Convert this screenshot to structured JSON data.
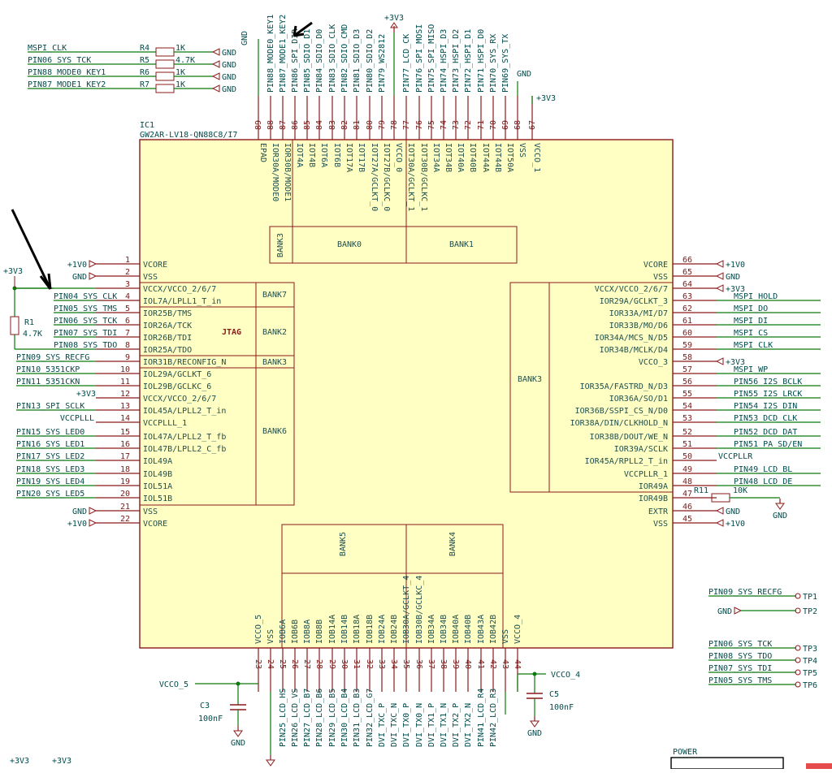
{
  "chip": {
    "ref": "IC1",
    "part": "GW2AR-LV18-QN88C8/I7",
    "epad": "EPAD"
  },
  "banks": {
    "top_left": "BANK3",
    "top_mid": "BANK0",
    "top_right": "BANK1",
    "left_b7": "BANK7",
    "left_b2": "BANK2",
    "left_jtag": "JTAG",
    "left_b3": "BANK3",
    "left_b6": "BANK6",
    "right_b3": "BANK3",
    "bottom_b5": "BANK5",
    "bottom_b4": "BANK4"
  },
  "left_pins": [
    {
      "num": "1",
      "name": "VCORE",
      "net": "+1V0"
    },
    {
      "num": "2",
      "name": "VSS",
      "net": "GND"
    },
    {
      "num": "3",
      "name": "VCCX/VCCO_2/6/7",
      "net": "+3V3"
    },
    {
      "num": "4",
      "name": "IOL7A/LPLL1_T_in",
      "net": "PIN04_SYS_CLK"
    },
    {
      "num": "5",
      "name": "IOR25B/TMS",
      "net": "PIN05_SYS_TMS"
    },
    {
      "num": "6",
      "name": "IOR26A/TCK",
      "net": "PIN06_SYS_TCK"
    },
    {
      "num": "7",
      "name": "IOR26B/TDI",
      "net": "PIN07_SYS_TDI"
    },
    {
      "num": "8",
      "name": "IOR25A/TDO",
      "net": "PIN08_SYS_TDO"
    },
    {
      "num": "9",
      "name": "IOR31B/RECONFIG_N",
      "net": "PIN09_SYS_RECFG"
    },
    {
      "num": "10",
      "name": "IOL29A/GCLKT_6",
      "net": "PIN10_5351CKP"
    },
    {
      "num": "11",
      "name": "IOL29B/GCLKC_6",
      "net": "PIN11_5351CKN"
    },
    {
      "num": "12",
      "name": "VCCX/VCCO_2/6/7",
      "net": "+3V3"
    },
    {
      "num": "13",
      "name": "IOL45A/LPLL2_T_in",
      "net": "PIN13_SPI_SCLK"
    },
    {
      "num": "14",
      "name": "VCCPLLL_1",
      "net": "VCCPLLL"
    },
    {
      "num": "15",
      "name": "IOL47A/LPLL2_T_fb",
      "net": "PIN15_SYS_LED0"
    },
    {
      "num": "16",
      "name": "IOL47B/LPLL2_C_fb",
      "net": "PIN16_SYS_LED1"
    },
    {
      "num": "17",
      "name": "IOL49A",
      "net": "PIN17_SYS_LED2"
    },
    {
      "num": "18",
      "name": "IOL49B",
      "net": "PIN18_SYS_LED3"
    },
    {
      "num": "19",
      "name": "IOL51A",
      "net": "PIN19_SYS_LED4"
    },
    {
      "num": "20",
      "name": "IOL51B",
      "net": "PIN20_SYS_LED5"
    },
    {
      "num": "21",
      "name": "VSS",
      "net": "GND"
    },
    {
      "num": "22",
      "name": "VCORE",
      "net": "+1V0"
    }
  ],
  "right_pins": [
    {
      "num": "66",
      "name": "VCORE",
      "net": "+1V0"
    },
    {
      "num": "65",
      "name": "VSS",
      "net": "GND"
    },
    {
      "num": "64",
      "name": "VCCX/VCCO_2/6/7",
      "net": "+3V3"
    },
    {
      "num": "63",
      "name": "IOR29A/GCLKT_3",
      "net": "MSPI_HOLD"
    },
    {
      "num": "62",
      "name": "IOR33A/MI/D7",
      "net": "MSPI_DO"
    },
    {
      "num": "61",
      "name": "IOR33B/MO/D6",
      "net": "MSPI_DI"
    },
    {
      "num": "60",
      "name": "IOR34A/MCS_N/D5",
      "net": "MSPI_CS"
    },
    {
      "num": "59",
      "name": "IOR34B/MCLK/D4",
      "net": "MSPI_CLK"
    },
    {
      "num": "58",
      "name": "VCCO_3",
      "net": "+3V3"
    },
    {
      "num": "57",
      "name": "",
      "net": "MSPI_WP"
    },
    {
      "num": "56",
      "name": "IOR35A/FASTRD_N/D3",
      "net": "PIN56_I2S_BCLK"
    },
    {
      "num": "55",
      "name": "IOR36A/SO/D1",
      "net": "PIN55_I2S_LRCK"
    },
    {
      "num": "54",
      "name": "IOR36B/SSPI_CS_N/D0",
      "net": "PIN54_I2S_DIN"
    },
    {
      "num": "53",
      "name": "IOR38A/DIN/CLKHOLD_N",
      "net": "PIN53_DCD_CLK"
    },
    {
      "num": "52",
      "name": "IOR38B/DOUT/WE_N",
      "net": "PIN52_DCD_DAT"
    },
    {
      "num": "51",
      "name": "IOR39A/SCLK",
      "net": "PIN51_PA_SD/EN"
    },
    {
      "num": "50",
      "name": "IOR45A/RPLL2_T_in",
      "net": "VCCPLLR"
    },
    {
      "num": "49",
      "name": "VCCPLLR_1",
      "net": "PIN49_LCD_BL"
    },
    {
      "num": "48",
      "name": "IOR49A",
      "net": "PIN48_LCD_DE"
    },
    {
      "num": "47",
      "name": "IOR49B",
      "net": "R11"
    },
    {
      "num": "46",
      "name": "EXTR",
      "net": "GND"
    },
    {
      "num": "45",
      "name": "VSS",
      "net": "+1V0"
    }
  ],
  "right_extra_names": {
    "vcore_bottom": "VCORE"
  },
  "top_pins": [
    {
      "num": "89",
      "name": "EPAD",
      "net": ""
    },
    {
      "num": "88",
      "name": "IOR30A/MODE0",
      "net": "PIN88_MODE0_KEY1"
    },
    {
      "num": "87",
      "name": "IOR30B/MODE1",
      "net": "PIN87_MODE1_KEY2"
    },
    {
      "num": "86",
      "name": "IOT4A",
      "net": "PIN86_SPI_DIR"
    },
    {
      "num": "85",
      "name": "IOT4B",
      "net": "PIN85_SDIO_D1"
    },
    {
      "num": "84",
      "name": "IOT6A",
      "net": "PIN84_SDIO_D0"
    },
    {
      "num": "83",
      "name": "IOT6B",
      "net": "PIN83_SDIO_CLK"
    },
    {
      "num": "82",
      "name": "IOT17A",
      "net": "PIN82_SDIO_CMD"
    },
    {
      "num": "81",
      "name": "IOT17B",
      "net": "PIN81_SDIO_D3"
    },
    {
      "num": "80",
      "name": "IOT27A/GCLKT_0",
      "net": "PIN80_SDIO_D2"
    },
    {
      "num": "79",
      "name": "IOT27B/GCLKC_0",
      "net": "PIN79_WS2812"
    },
    {
      "num": "78",
      "name": "VCCO_0",
      "net": "+3V3"
    },
    {
      "num": "77",
      "name": "IOT30A/GCLKT_1",
      "net": "PIN77_LCD_CK"
    },
    {
      "num": "76",
      "name": "IOT30B/GCLKC_1",
      "net": "PIN76_SPI_MOSI"
    },
    {
      "num": "75",
      "name": "IOT34A",
      "net": "PIN75_SPI_MISO"
    },
    {
      "num": "74",
      "name": "IOT34B",
      "net": "PIN74_HSPI_D3"
    },
    {
      "num": "73",
      "name": "IOT40A",
      "net": "PIN73_HSPI_D2"
    },
    {
      "num": "72",
      "name": "IOT40B",
      "net": "PIN72_HSPI_D1"
    },
    {
      "num": "71",
      "name": "IOT44A",
      "net": "PIN71_HSPI_D0"
    },
    {
      "num": "70",
      "name": "IOT44B",
      "net": "PIN70_SYS_RX"
    },
    {
      "num": "69",
      "name": "IOT50A",
      "net": "PIN69_SYS_TX"
    },
    {
      "num": "68",
      "name": "VSS",
      "net": "GND"
    },
    {
      "num": "67",
      "name": "VCCO_1",
      "net": "+3V3"
    }
  ],
  "bottom_pins": [
    {
      "num": "23",
      "name": "VCCO_5",
      "net": "VCCO_5"
    },
    {
      "num": "24",
      "name": "VSS",
      "net": "GND"
    },
    {
      "num": "25",
      "name": "IOB6A",
      "net": "PIN25_LCD_HS"
    },
    {
      "num": "26",
      "name": "IOB6B",
      "net": "PIN26_LCD_VS"
    },
    {
      "num": "27",
      "name": "IOB8A",
      "net": "PIN27_LCD_B7"
    },
    {
      "num": "28",
      "name": "IOB8B",
      "net": "PIN28_LCD_B6"
    },
    {
      "num": "29",
      "name": "IOB14A",
      "net": "PIN29_LCD_B5"
    },
    {
      "num": "30",
      "name": "IOB14B",
      "net": "PIN30_LCD_B4"
    },
    {
      "num": "31",
      "name": "IOB18A",
      "net": "PIN31_LCD_B3"
    },
    {
      "num": "32",
      "name": "IOB18B",
      "net": "PIN32_LCD_G7"
    },
    {
      "num": "33",
      "name": "IOB24A",
      "net": "DVI_TXC_P"
    },
    {
      "num": "34",
      "name": "IOB24B",
      "net": "DVI_TXC_N"
    },
    {
      "num": "35",
      "name": "IOB30A/GCLKT_4",
      "net": "DVI_TX0_P"
    },
    {
      "num": "36",
      "name": "IOB30B/GCLKC_4",
      "net": "DVI_TX0_N"
    },
    {
      "num": "37",
      "name": "IOB34A",
      "net": "DVI_TX1_P"
    },
    {
      "num": "38",
      "name": "IOB34B",
      "net": "DVI_TX1_N"
    },
    {
      "num": "39",
      "name": "IOB40A",
      "net": "DVI_TX2_P"
    },
    {
      "num": "40",
      "name": "IOB40B",
      "net": "DVI_TX2_N"
    },
    {
      "num": "41",
      "name": "IOB43A",
      "net": "PIN41_LCD_R4"
    },
    {
      "num": "42",
      "name": "IOB42B",
      "net": "PIN42_LCD_R3"
    },
    {
      "num": "43",
      "name": "VSS",
      "net": "GND"
    },
    {
      "num": "44",
      "name": "VCCO_4",
      "net": "VCCO_4"
    }
  ],
  "resistors": [
    {
      "ref": "R4",
      "value": "1K",
      "net": "MSPI_CLK"
    },
    {
      "ref": "R5",
      "value": "4.7K",
      "net": "PIN06_SYS_TCK"
    },
    {
      "ref": "R6",
      "value": "1K",
      "net": "PIN88_MODE0_KEY1"
    },
    {
      "ref": "R7",
      "value": "1K",
      "net": "PIN87_MODE1_KEY2"
    }
  ],
  "r1": {
    "ref": "R1",
    "value": "4.7K"
  },
  "r11": {
    "ref": "R11",
    "value": "10K"
  },
  "caps": [
    {
      "ref": "C3",
      "value": "100nF",
      "net": "VCCO_5"
    },
    {
      "ref": "C5",
      "value": "100nF",
      "net": "VCCO_4"
    }
  ],
  "testpoints": [
    {
      "net": "PIN09_SYS_RECFG",
      "label": "TP1"
    },
    {
      "net": "GND",
      "label": "TP2"
    },
    {
      "net": "PIN06_SYS_TCK",
      "label": "TP3"
    },
    {
      "net": "PIN08_SYS_TDO",
      "label": "TP4"
    },
    {
      "net": "PIN07_SYS_TDI",
      "label": "TP5"
    },
    {
      "net": "PIN05_SYS_TMS",
      "label": "TP6"
    }
  ],
  "power_labels": {
    "p3v3": "+3V3",
    "p1v0": "+1V0",
    "gnd": "GND",
    "vccplll": "VCCPLLL",
    "vccpllr": "VCCPLLR",
    "vcco5": "VCCO_5",
    "vcco4": "VCCO_4"
  },
  "bottom_strip": {
    "power_box": "POWER",
    "left_p3v3_a": "+3V3",
    "left_p3v3_b": "+3V3"
  }
}
